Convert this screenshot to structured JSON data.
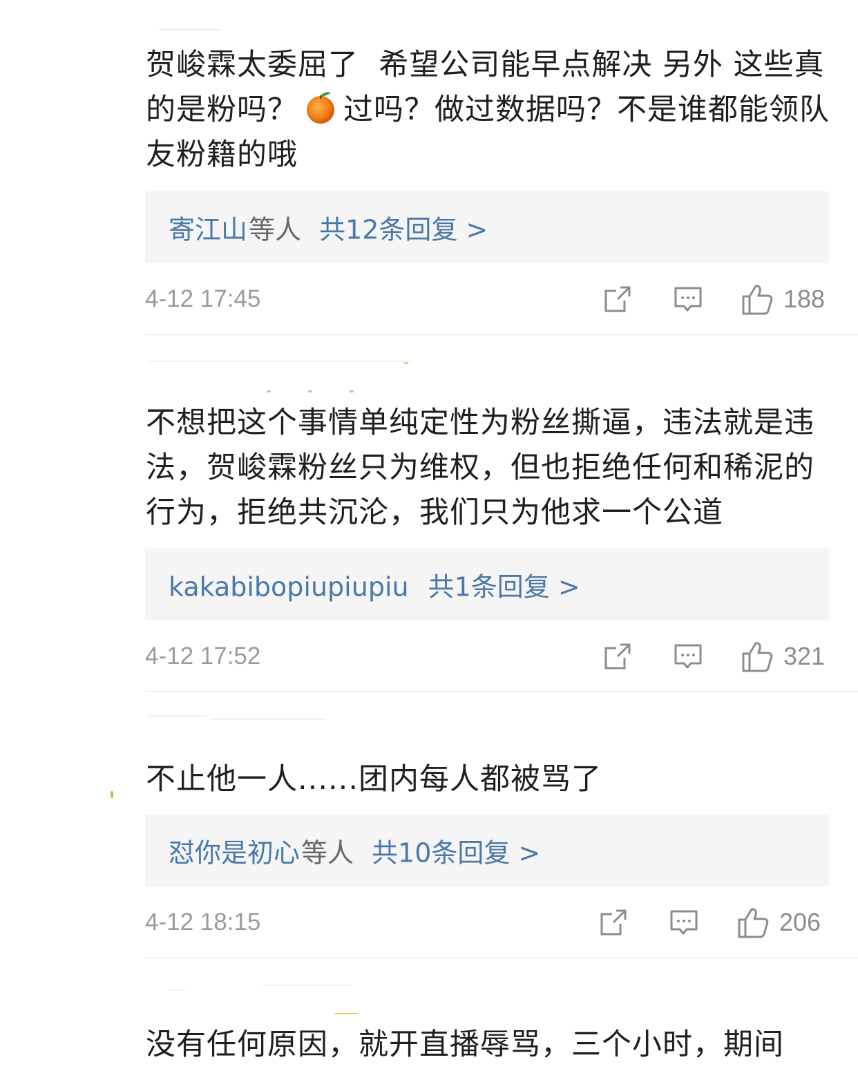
{
  "comments": [
    {
      "text_before_emoji": "贺峻霖太委屈了  希望公司能早点解决 另外 这些真的是粉吗？",
      "text_after_emoji": "过吗？做过数据吗？不是谁都能领队友粉籍的哦",
      "emoji": "tangerine-emoji",
      "reply_users": "寄江山",
      "reply_etc": "等人",
      "reply_total": "共12条回复 >",
      "time": "4-12 17:45",
      "likes": "188"
    },
    {
      "text": "不想把这个事情单纯定性为粉丝撕逼，违法就是违法，贺峻霖粉丝只为维权，但也拒绝任何和稀泥的行为，拒绝共沉沦，我们只为他求一个公道",
      "reply_users": "kakabibopiupiupiu",
      "reply_etc": "",
      "reply_total": "共1条回复 >",
      "time": "4-12 17:52",
      "likes": "321"
    },
    {
      "text": "不止他一人......团内每人都被骂了",
      "reply_users": "怼你是初心",
      "reply_etc": "等人",
      "reply_total": "共10条回复 >",
      "time": "4-12 18:15",
      "likes": "206"
    },
    {
      "text": "没有任何原因，就开直播辱骂，三个小时，期间"
    }
  ],
  "colors": {
    "link": "#4a78a9",
    "meta": "#9b9b9b",
    "reply_bg": "#f5f5f5",
    "icon": "#8c8c8c"
  }
}
